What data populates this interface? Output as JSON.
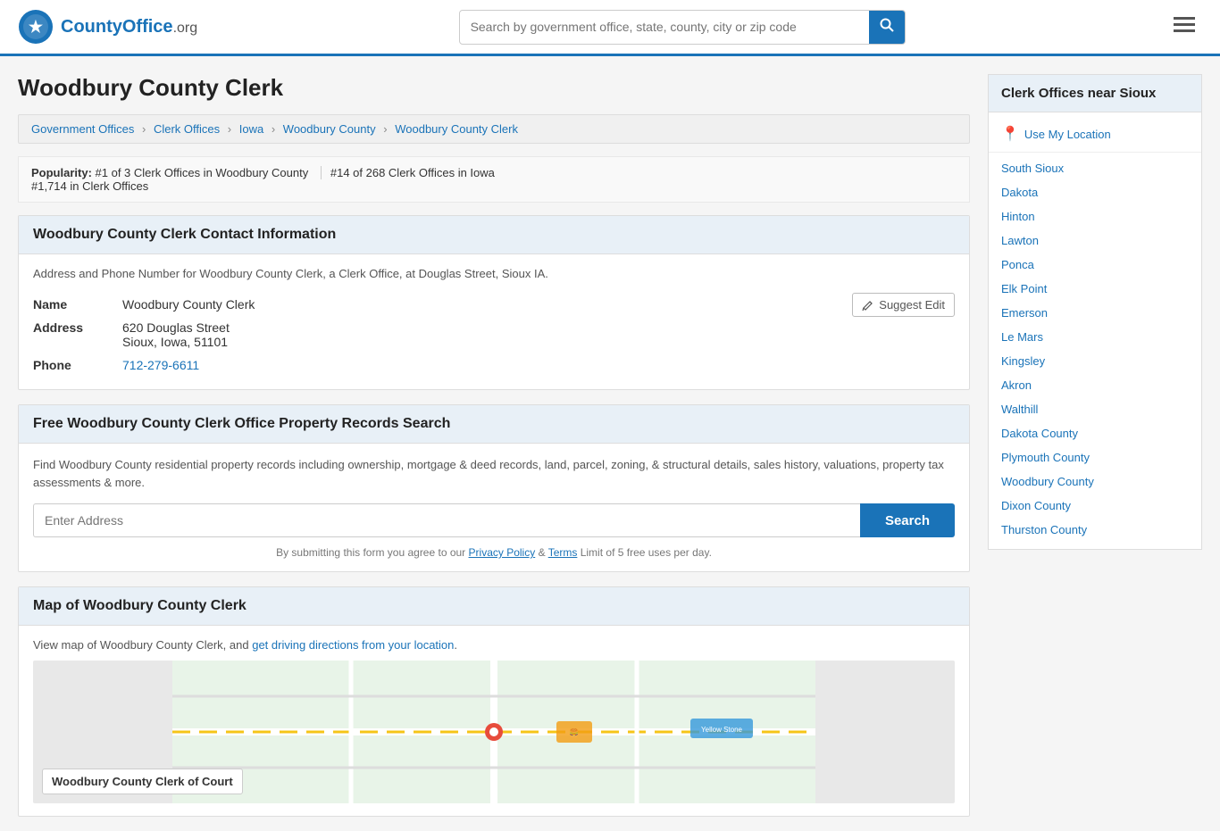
{
  "header": {
    "logo_text": "CountyOffice",
    "logo_suffix": ".org",
    "search_placeholder": "Search by government office, state, county, city or zip code"
  },
  "page": {
    "title": "Woodbury County Clerk",
    "breadcrumb": [
      {
        "label": "Government Offices",
        "href": "#"
      },
      {
        "label": "Clerk Offices",
        "href": "#"
      },
      {
        "label": "Iowa",
        "href": "#"
      },
      {
        "label": "Woodbury County",
        "href": "#"
      },
      {
        "label": "Woodbury County Clerk",
        "href": "#"
      }
    ],
    "popularity_label": "Popularity:",
    "popularity_rank1": "#1 of 3 Clerk Offices in Woodbury County",
    "popularity_rank2": "#14 of 268 Clerk Offices in Iowa",
    "popularity_rank3": "#1,714 in Clerk Offices"
  },
  "contact": {
    "section_title": "Woodbury County Clerk Contact Information",
    "description": "Address and Phone Number for Woodbury County Clerk, a Clerk Office, at Douglas Street, Sioux IA.",
    "name_label": "Name",
    "name_value": "Woodbury County Clerk",
    "address_label": "Address",
    "address_line1": "620 Douglas Street",
    "address_line2": "Sioux, Iowa, 51101",
    "phone_label": "Phone",
    "phone_value": "712-279-6611",
    "suggest_edit": "Suggest Edit"
  },
  "property_search": {
    "section_title": "Free Woodbury County Clerk Office Property Records Search",
    "description": "Find Woodbury County residential property records including ownership, mortgage & deed records, land, parcel, zoning, & structural details, sales history, valuations, property tax assessments & more.",
    "input_placeholder": "Enter Address",
    "button_label": "Search",
    "privacy_text": "By submitting this form you agree to our",
    "privacy_link": "Privacy Policy",
    "and_text": "&",
    "terms_link": "Terms",
    "limit_text": "Limit of 5 free uses per day."
  },
  "map_section": {
    "section_title": "Map of Woodbury County Clerk",
    "description": "View map of Woodbury County Clerk, and",
    "directions_link": "get driving directions from your location",
    "map_label": "Woodbury County Clerk of Court"
  },
  "sidebar": {
    "title": "Clerk Offices near Sioux",
    "use_my_location": "Use My Location",
    "items": [
      {
        "label": "South Sioux",
        "href": "#"
      },
      {
        "label": "Dakota",
        "href": "#"
      },
      {
        "label": "Hinton",
        "href": "#"
      },
      {
        "label": "Lawton",
        "href": "#"
      },
      {
        "label": "Ponca",
        "href": "#"
      },
      {
        "label": "Elk Point",
        "href": "#"
      },
      {
        "label": "Emerson",
        "href": "#"
      },
      {
        "label": "Le Mars",
        "href": "#"
      },
      {
        "label": "Kingsley",
        "href": "#"
      },
      {
        "label": "Akron",
        "href": "#"
      },
      {
        "label": "Walthill",
        "href": "#"
      },
      {
        "label": "Dakota County",
        "href": "#"
      },
      {
        "label": "Plymouth County",
        "href": "#"
      },
      {
        "label": "Woodbury County",
        "href": "#"
      },
      {
        "label": "Dixon County",
        "href": "#"
      },
      {
        "label": "Thurston County",
        "href": "#"
      }
    ]
  }
}
